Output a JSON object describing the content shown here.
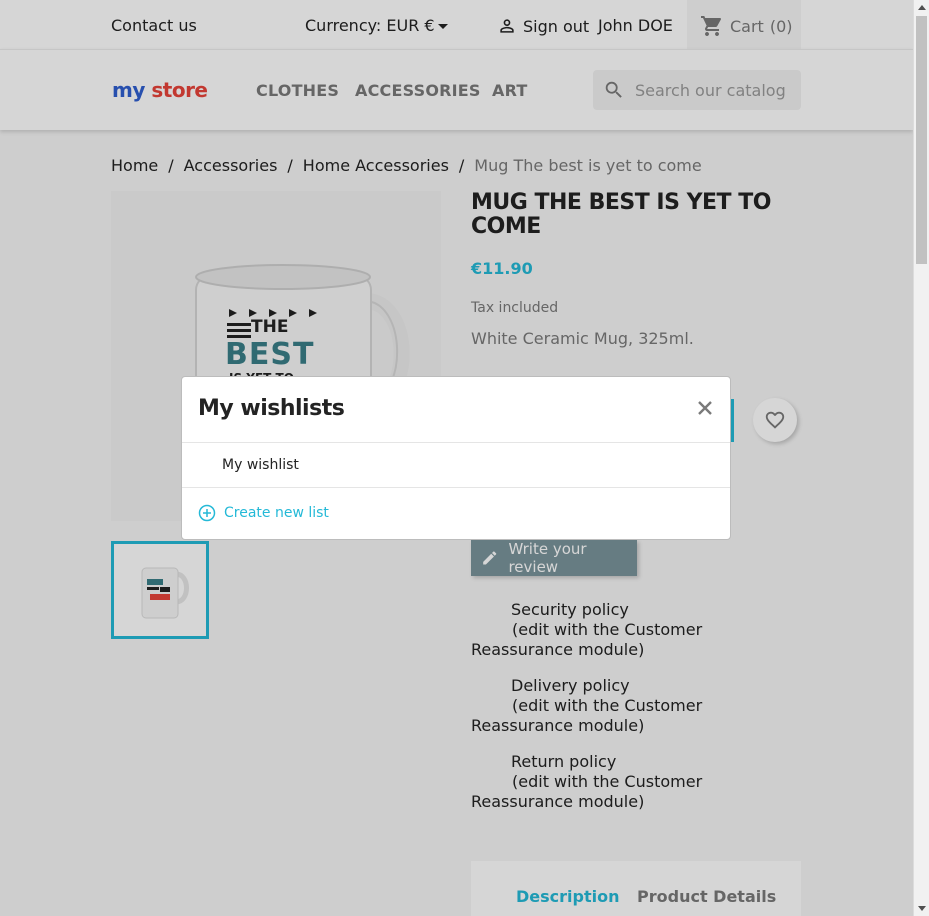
{
  "topbar": {
    "contact": "Contact us",
    "currency_label": "Currency:",
    "currency_value": "EUR €",
    "signout": "Sign out",
    "user": "John DOE",
    "cart": "Cart",
    "cart_count": "(0)"
  },
  "header": {
    "logo_part1": "my",
    "logo_part2": "store",
    "nav": [
      "CLOTHES",
      "ACCESSORIES",
      "ART"
    ],
    "search_placeholder": "Search our catalog"
  },
  "breadcrumb": [
    "Home",
    "Accessories",
    "Home Accessories",
    "Mug The best is yet to come"
  ],
  "product": {
    "title": "MUG THE BEST IS YET TO COME",
    "price": "€11.90",
    "tax": "Tax included",
    "description": "White Ceramic Mug, 325ml.",
    "review_button": "Write your review",
    "mug_text_top": "THE",
    "mug_text_mid": "BEST",
    "mug_text_bot": "IS YET TO"
  },
  "reassurance": [
    {
      "title": "Security policy",
      "sub": "(edit with the Customer Reassurance module)"
    },
    {
      "title": "Delivery policy",
      "sub": "(edit with the Customer Reassurance module)"
    },
    {
      "title": "Return policy",
      "sub": "(edit with the Customer Reassurance module)"
    }
  ],
  "tabs": [
    "Description",
    "Product Details"
  ],
  "modal": {
    "title": "My wishlists",
    "lists": [
      "My wishlist"
    ],
    "create": "Create new list"
  },
  "colors": {
    "accent": "#24b9d7",
    "review_button": "#7a949b"
  }
}
